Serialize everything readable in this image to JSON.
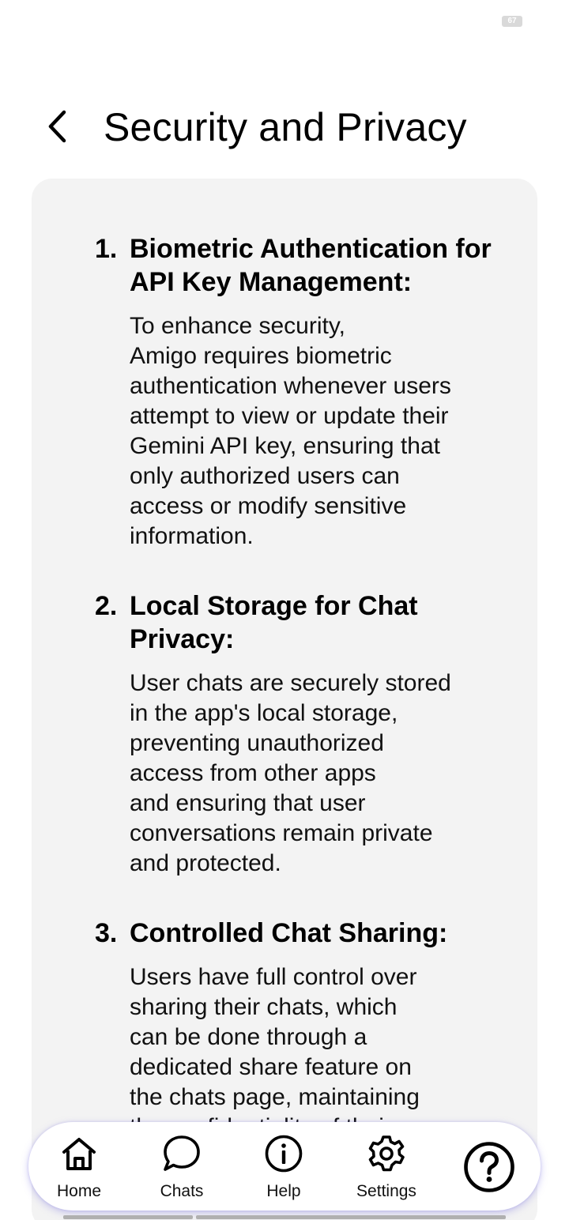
{
  "status_bar": {
    "battery": "67"
  },
  "header": {
    "title": "Security and Privacy"
  },
  "sections": [
    {
      "number": "1.",
      "title": "Biometric Authentication for API Key Management:",
      "body_lines": [
        "To enhance security,",
        "Amigo requires biometric",
        "authentication whenever users",
        "attempt to view or update their",
        "Gemini API key, ensuring that",
        "only authorized users can",
        "access or modify sensitive",
        "information."
      ]
    },
    {
      "number": "2.",
      "title": "Local Storage for Chat Privacy:",
      "body_lines": [
        "User chats are securely stored",
        "in the app's local storage,",
        "preventing unauthorized",
        "access from other apps",
        "and ensuring that user",
        "conversations remain private",
        "and protected."
      ]
    },
    {
      "number": "3.",
      "title": "Controlled Chat Sharing:",
      "body_lines": [
        "Users have full control over",
        "sharing their chats, which",
        "can be done through a",
        "dedicated share feature on",
        "the chats page, maintaining",
        "the confidentiality of their"
      ]
    }
  ],
  "nav": {
    "items": [
      {
        "label": "Home",
        "icon": "home-icon"
      },
      {
        "label": "Chats",
        "icon": "chat-bubble-icon"
      },
      {
        "label": "Help",
        "icon": "info-icon"
      },
      {
        "label": "Settings",
        "icon": "gear-icon"
      }
    ],
    "fab_icon": "question-mark-icon"
  },
  "colors": {
    "card_background": "#f3f3f3",
    "nav_shadow": "#6e64dc"
  }
}
